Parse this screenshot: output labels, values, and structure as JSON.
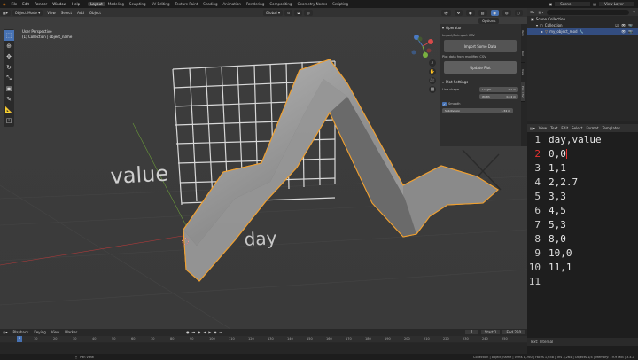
{
  "topbar": {
    "menus": [
      "File",
      "Edit",
      "Render",
      "Window",
      "Help"
    ],
    "workspaces": [
      "Layout",
      "Modeling",
      "Sculpting",
      "UV Editing",
      "Texture Paint",
      "Shading",
      "Animation",
      "Rendering",
      "Compositing",
      "Geometry Nodes",
      "Scripting"
    ],
    "active_workspace": "Layout",
    "scene": "Scene",
    "view_layer": "View Layer"
  },
  "viewport": {
    "mode": "Object Mode",
    "menus": [
      "View",
      "Select",
      "Add",
      "Object"
    ],
    "transform_orientation": "Global",
    "options_label": "Options",
    "info_line1": "User Perspective",
    "info_line2": "(1) Collection | object_name",
    "axis_label_value": "value",
    "axis_label_day": "day",
    "gizmo_axes": [
      "X",
      "Y",
      "Z"
    ]
  },
  "npanel": {
    "tabs": [
      "Item",
      "Tool",
      "View",
      "Plot CSV"
    ],
    "operator_title": "Operator",
    "import_label": "Import/Reimport CSV",
    "import_button": "Import Some Data",
    "plot_label": "Plot data from modified CSV",
    "update_button": "Update Plot",
    "plot_settings_title": "Plot Settings",
    "line_shape_label": "Line shape",
    "length_label": "Length",
    "length_value": "1.1 m",
    "width_label": "Width",
    "width_value": "0.24 m",
    "smooth_label": "Smooth",
    "subdiv_label": "Subdivision",
    "subdiv_value": "1.34 m"
  },
  "outliner": {
    "root": "Scene Collection",
    "collection": "Collection",
    "object": "my_object_mod"
  },
  "text_editor": {
    "menus": [
      "View",
      "Text",
      "Edit",
      "Select",
      "Format",
      "Templates"
    ],
    "current_line": 2,
    "lines": [
      "day,value",
      "0,0",
      "1,1",
      "2,2.7",
      "3,3",
      "4,5",
      "5,3",
      "8,0",
      "10,0",
      "11,1",
      ""
    ],
    "footer": "Text: Internal"
  },
  "timeline": {
    "menus": [
      "Playback",
      "Keying",
      "View",
      "Marker"
    ],
    "current_frame": "1",
    "start_label": "Start",
    "start_value": "1",
    "end_label": "End",
    "end_value": "250",
    "ticks": [
      "10",
      "20",
      "30",
      "40",
      "50",
      "60",
      "70",
      "80",
      "90",
      "100",
      "110",
      "120",
      "130",
      "140",
      "150",
      "160",
      "170",
      "180",
      "190",
      "200",
      "210",
      "220",
      "230",
      "240",
      "250"
    ]
  },
  "statusbar": {
    "left": "Pan View",
    "right": "Collection | object_name | Verts 1,760 | Faces 1,658 | Tris 3,264 | Objects 1/4 | Memory: 19.9 MiB | 3.4.1"
  }
}
